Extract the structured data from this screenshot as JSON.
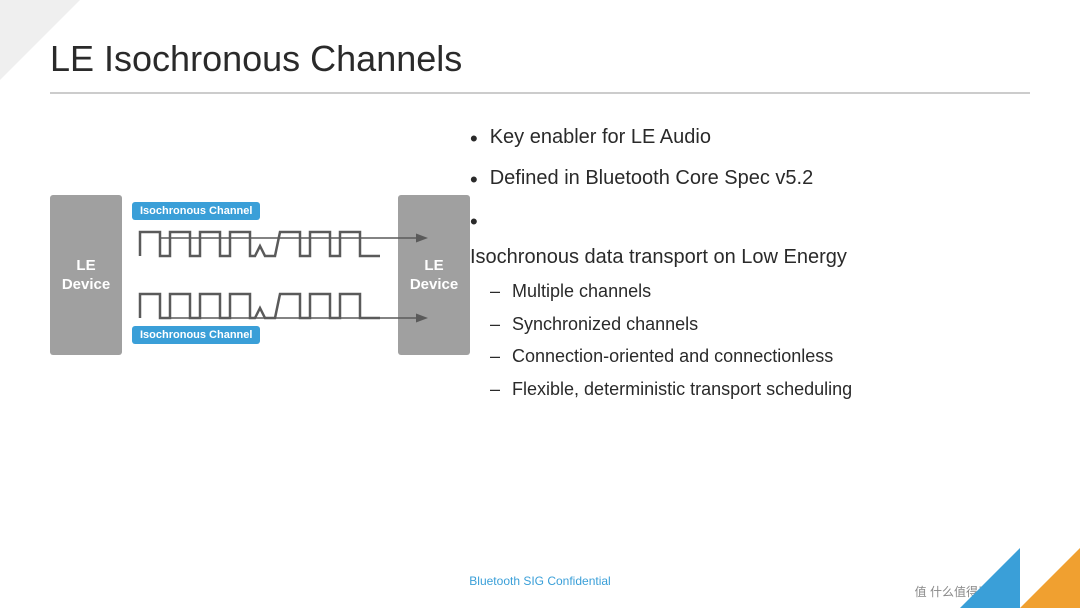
{
  "slide": {
    "title": "LE Isochronous Channels",
    "diagram": {
      "left_device": "LE\nDevice",
      "right_device": "LE\nDevice",
      "channel1_label": "Isochronous Channel",
      "channel2_label": "Isochronous Channel"
    },
    "bullets": [
      {
        "text": "Key enabler for LE Audio",
        "sub": []
      },
      {
        "text": "Defined in Bluetooth Core Spec v5.2",
        "sub": []
      },
      {
        "text": "Isochronous data transport on Low Energy",
        "sub": [
          "Multiple channels",
          "Synchronized channels",
          "Connection-oriented and connectionless",
          "Flexible, deterministic transport scheduling"
        ]
      }
    ],
    "footer": "Bluetooth SIG Confidential",
    "watermark": "值 什么值得买"
  }
}
